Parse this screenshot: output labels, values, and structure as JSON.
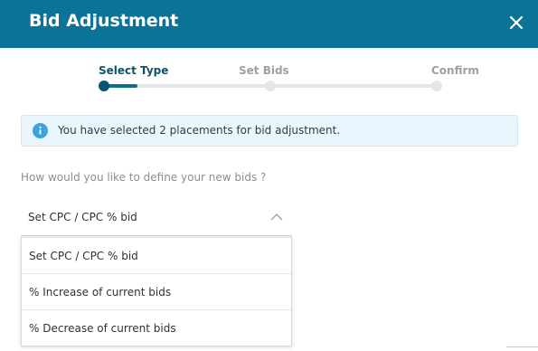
{
  "dialog": {
    "title": "Bid Adjustment",
    "close_icon": "close-icon"
  },
  "steps": [
    {
      "label": "Select Type",
      "active": true
    },
    {
      "label": "Set Bids",
      "active": false
    },
    {
      "label": "Confirm",
      "active": false
    }
  ],
  "info": {
    "icon": "info-icon",
    "text": "You have selected 2 placements for bid adjustment."
  },
  "question": "How would you like to define your new bids ?",
  "select": {
    "value": "Set CPC / CPC % bid",
    "icon": "chevron-up-icon"
  },
  "options": [
    "Set CPC / CPC % bid",
    "% Increase of current bids",
    "% Decrease of current bids"
  ],
  "colors": {
    "header": "#0a7397",
    "active_step": "#10526c",
    "inactive_step": "#9aa0a3",
    "info_bg": "#eaf6fd",
    "info_icon": "#3aa3e0"
  }
}
